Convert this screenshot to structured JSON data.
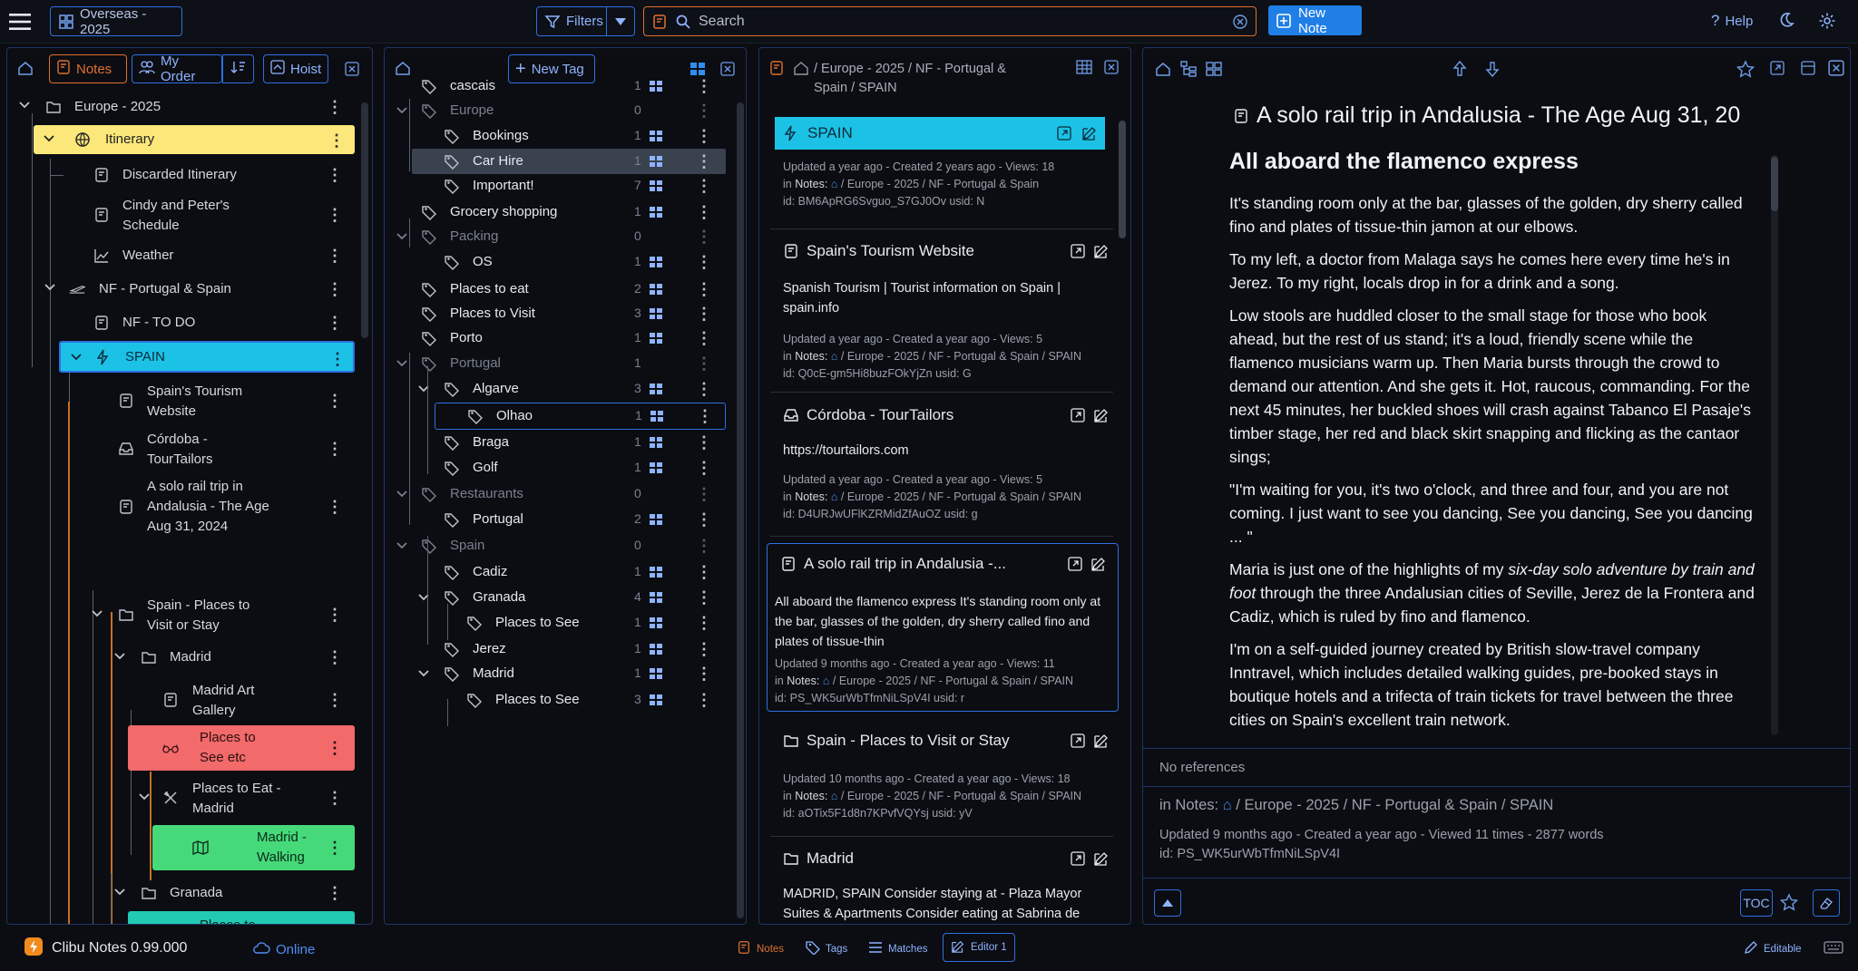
{
  "top": {
    "database": "Overseas - 2025",
    "filters": "Filters",
    "search_placeholder": "Search",
    "new_note": "New Note",
    "help": "Help"
  },
  "notes_panel": {
    "tab_notes": "Notes",
    "tab_order": "My Order",
    "tab_hoist": "Hoist",
    "tree": [
      {
        "label": "Europe - 2025"
      },
      {
        "label": "Itinerary"
      },
      {
        "label": "Discarded Itinerary"
      },
      {
        "label": "Cindy and Peter's Schedule"
      },
      {
        "label": "Weather"
      },
      {
        "label": "NF - Portugal & Spain"
      },
      {
        "label": "NF - TO DO"
      },
      {
        "label": "SPAIN"
      },
      {
        "label": "Spain's Tourism Website"
      },
      {
        "label": "Córdoba - TourTailors"
      },
      {
        "label": "A solo rail trip in Andalusia - The Age Aug 31, 2024"
      },
      {
        "label": "Spain - Places to Visit or Stay"
      },
      {
        "label": "Madrid"
      },
      {
        "label": "Madrid Art Gallery"
      },
      {
        "label": "Places to See etc"
      },
      {
        "label": "Places to Eat - Madrid"
      },
      {
        "label": "Madrid - Walking"
      },
      {
        "label": "Granada"
      },
      {
        "label": "Places to See - Granada"
      }
    ]
  },
  "tags_panel": {
    "new_tag": "New Tag",
    "tags": [
      {
        "label": "cascais",
        "count": "1"
      },
      {
        "label": "Europe",
        "count": "0"
      },
      {
        "label": "Bookings",
        "count": "1"
      },
      {
        "label": "Car Hire",
        "count": "1"
      },
      {
        "label": "Important!",
        "count": "7"
      },
      {
        "label": "Grocery shopping",
        "count": "1"
      },
      {
        "label": "Packing",
        "count": "0"
      },
      {
        "label": "OS",
        "count": "1"
      },
      {
        "label": "Places to eat",
        "count": "2"
      },
      {
        "label": "Places to Visit",
        "count": "3"
      },
      {
        "label": "Porto",
        "count": "1"
      },
      {
        "label": "Portugal",
        "count": "1"
      },
      {
        "label": "Algarve",
        "count": "3"
      },
      {
        "label": "Olhao",
        "count": "1"
      },
      {
        "label": "Braga",
        "count": "1"
      },
      {
        "label": "Golf",
        "count": "1"
      },
      {
        "label": "Restaurants",
        "count": "0"
      },
      {
        "label": "Portugal",
        "count": "2"
      },
      {
        "label": "Spain",
        "count": "0"
      },
      {
        "label": "Cadiz",
        "count": "1"
      },
      {
        "label": "Granada",
        "count": "4"
      },
      {
        "label": "Places to See",
        "count": "1"
      },
      {
        "label": "Jerez",
        "count": "1"
      },
      {
        "label": "Madrid",
        "count": "1"
      },
      {
        "label": "Places to See",
        "count": "3"
      }
    ]
  },
  "list_panel": {
    "breadcrumb": "/ Europe - 2025 / NF - Portugal & Spain / SPAIN",
    "cards": [
      {
        "title": "SPAIN",
        "body": "",
        "meta1": "Updated a year ago - Created 2 years ago - Views: 18",
        "path": "/ Europe - 2025 / NF - Portugal & Spain",
        "id": "id: BM6ApRG6Svguo_S7GJ0Ov usid: N"
      },
      {
        "title": "Spain's Tourism Website",
        "body": "Spanish Tourism | Tourist information on Spain | spain.info",
        "meta1": "Updated a year ago - Created a year ago - Views: 5",
        "path": "/ Europe - 2025 / NF - Portugal & Spain / SPAIN",
        "id": "id: Q0cE-gm5Hi8buzFOkYjZn usid: G"
      },
      {
        "title": "Córdoba - TourTailors",
        "body": "https://tourtailors.com",
        "meta1": "Updated a year ago - Created a year ago - Views: 5",
        "path": "/ Europe - 2025 / NF - Portugal & Spain / SPAIN",
        "id": "id: D4URJwUFlKZRMidZfAuOZ usid: g"
      },
      {
        "title": "A solo rail trip in Andalusia -...",
        "body": "All aboard the flamenco express It's standing room only at the bar, glasses of the golden, dry sherry called fino and plates of tissue-thin",
        "meta1": "Updated 9 months ago - Created a year ago - Views: 11",
        "path": "/ Europe - 2025 / NF - Portugal & Spain / SPAIN",
        "id": "id: PS_WK5urWbTfmNiLSpV4I usid: r"
      },
      {
        "title": "Spain - Places to Visit or Stay",
        "body": "",
        "meta1": "Updated 10 months ago - Created a year ago - Views: 18",
        "path": "/ Europe - 2025 / NF - Portugal & Spain / SPAIN",
        "id": "id: aOTix5F1d8n7KPvfVQYsj usid: yV"
      },
      {
        "title": "Madrid",
        "body": "MADRID, SPAIN Consider staying at - Plaza Mayor Suites & Apartments Consider eating at Sabrina de",
        "meta1": "",
        "path": "",
        "id": ""
      }
    ],
    "notes_label": "Notes:"
  },
  "editor": {
    "title": "A solo rail trip in Andalusia - The Age Aug 31, 20",
    "heading": "All aboard the flamenco express",
    "p1": "It's standing room only at the bar, glasses of the golden, dry sherry called fino and plates of tissue-thin jamon at our elbows.",
    "p2": "To my left, a doctor from Malaga says he comes here every time he's in Jerez. To my right, locals drop in for a drink and a song.",
    "p3": "Low stools are huddled closer to the small stage for those who book ahead, but the rest of us stand; it's a loud, friendly scene while the flamenco musicians warm up. Then Maria bursts through the crowd to demand our attention. And she gets it. Hot, raucous, commanding. For the next 45 minutes, her buckled shoes will crash against Tabanco El Pasaje's timber stage, her red and black skirt snapping and flicking as the cantaor sings;",
    "p4": "\"I'm waiting for you, it's two o'clock, and three and four, and you are not coming. I just want to see you dancing, See you dancing, See you dancing ... \"",
    "p5a": "Maria is just one of the highlights of my ",
    "p5em": "six-day solo adventure by train and foot",
    "p5b": " through the three Andalusian cities of Seville, Jerez de la Frontera and Cadiz, which is ruled by fino and flamenco.",
    "p6": "I'm on a self-guided journey created by British slow-travel company Inntravel, which includes detailed walking guides, pre-booked stays in boutique hotels and a trifecta of train tickets for travel between the three cities on Spain's excellent train network.",
    "no_refs": "No references",
    "in_notes": "in Notes:",
    "path": "/ Europe - 2025 / NF - Portugal & Spain / SPAIN",
    "meta": "Updated 9 months ago - Created a year ago - Viewed 11 times - 2877 words",
    "id": "id: PS_WK5urWbTfmNiLSpV4I",
    "toc": "TOC"
  },
  "status": {
    "app": "Clibu Notes 0.99.000",
    "online": "Online",
    "notes": "Notes",
    "tags": "Tags",
    "matches": "Matches",
    "editor": "Editor 1",
    "editable": "Editable"
  },
  "colors": {
    "accent": "#2f6fe0",
    "yellow": "#fbe77a",
    "cyan": "#1cc2e6",
    "red": "#f26a6a",
    "green": "#46d97a",
    "teal": "#22c9b3"
  }
}
